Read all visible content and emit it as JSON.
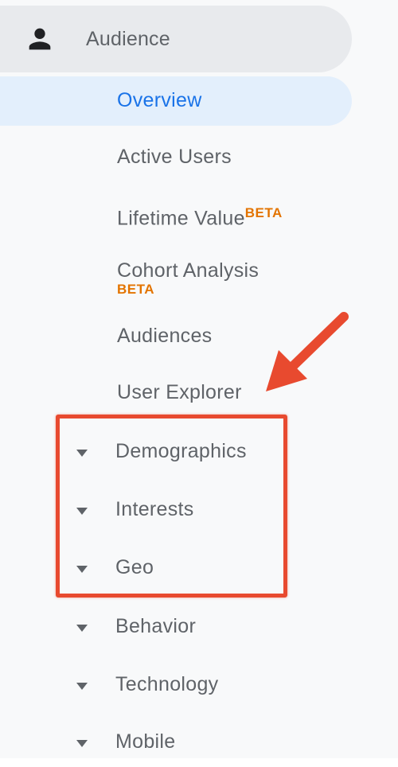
{
  "colors": {
    "selected_text": "#1a73e8",
    "selected_bg": "#e3effc",
    "header_bg": "#e8eaed",
    "text": "#5f6368",
    "beta": "#e37400",
    "annotation": "#e84a2f"
  },
  "header": {
    "icon": "person-icon",
    "label": "Audience"
  },
  "items": [
    {
      "label": "Overview",
      "selected": true
    },
    {
      "label": "Active Users"
    },
    {
      "label": "Lifetime Value",
      "badge": "BETA"
    },
    {
      "label": "Cohort Analysis",
      "badge": "BETA"
    },
    {
      "label": "Audiences"
    },
    {
      "label": "User Explorer"
    }
  ],
  "groups": [
    {
      "label": "Demographics",
      "icon": "caret-down-icon"
    },
    {
      "label": "Interests",
      "icon": "caret-down-icon"
    },
    {
      "label": "Geo",
      "icon": "caret-down-icon"
    },
    {
      "label": "Behavior",
      "icon": "caret-down-icon"
    },
    {
      "label": "Technology",
      "icon": "caret-down-icon"
    },
    {
      "label": "Mobile",
      "icon": "caret-down-icon"
    }
  ],
  "annotations": {
    "arrow": "red-arrow-icon",
    "box": "red-highlight-box"
  }
}
